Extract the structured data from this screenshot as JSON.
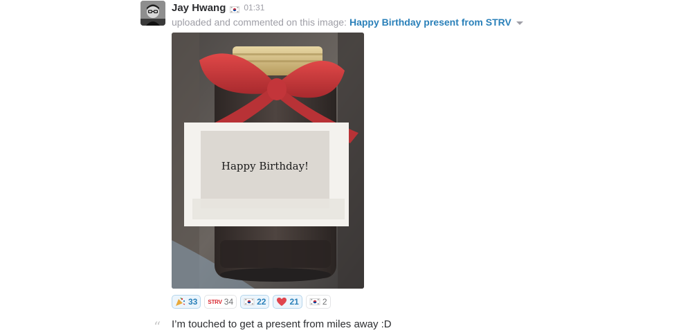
{
  "message": {
    "author": "Jay Hwang",
    "time": "01:31",
    "status_icon": "korea-flag-icon",
    "action_text": "uploaded and commented on this image:",
    "file_title": "Happy Birthday present from STRV",
    "image": {
      "label_text": "Happy Birthday!"
    },
    "reactions": [
      {
        "emoji": "tada-icon",
        "count": "33",
        "mine": true
      },
      {
        "emoji": "strv-icon",
        "label": "STRV",
        "count": "34",
        "mine": false
      },
      {
        "emoji": "korea-flag-icon",
        "count": "22",
        "mine": true
      },
      {
        "emoji": "heart-icon",
        "count": "21",
        "mine": true
      },
      {
        "emoji": "korea-flag-icon",
        "count": "2",
        "mine": false
      }
    ],
    "comment": "I’m touched to get a present from miles away :D"
  },
  "colors": {
    "link": "#2a80b9",
    "muted": "#9e9ea6",
    "text": "#2c2d30",
    "bow": "#c8373b"
  }
}
